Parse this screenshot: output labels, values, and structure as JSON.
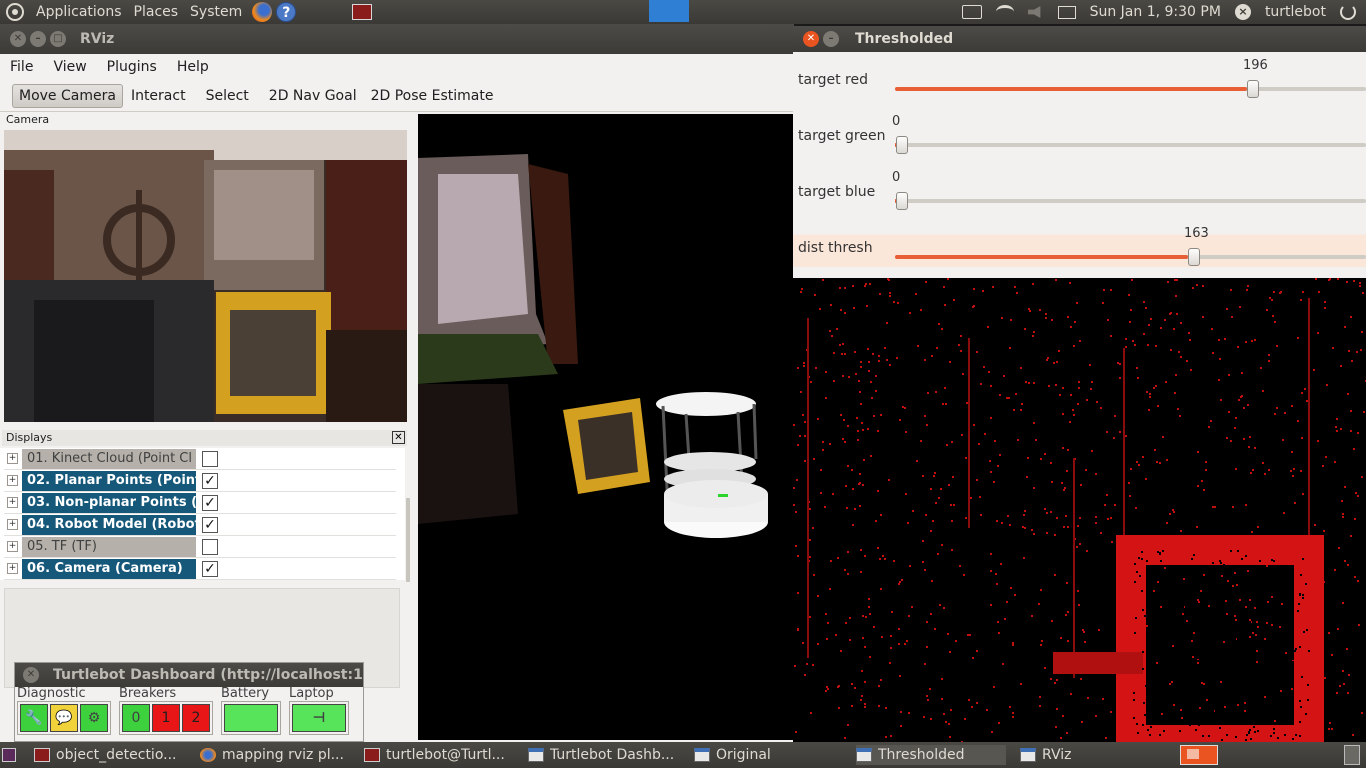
{
  "top_panel": {
    "menus": [
      "Applications",
      "Places",
      "System"
    ],
    "clock": "Sun Jan  1,  9:30 PM",
    "user": "turtlebot"
  },
  "rviz": {
    "title": "RViz",
    "menu": [
      "File",
      "View",
      "Plugins",
      "Help"
    ],
    "tools": [
      "Move Camera",
      "Interact",
      "Select",
      "2D Nav Goal",
      "2D Pose Estimate"
    ],
    "camera_label": "Camera",
    "displays_label": "Displays",
    "displays": [
      {
        "label": "01. Kinect Cloud (Point Cl",
        "checked": false,
        "enabled": false
      },
      {
        "label": "02. Planar Points (Point",
        "checked": true,
        "enabled": true
      },
      {
        "label": "03. Non-planar Points (P",
        "checked": true,
        "enabled": true
      },
      {
        "label": "04. Robot Model (Robot",
        "checked": true,
        "enabled": true
      },
      {
        "label": "05. TF (TF)",
        "checked": false,
        "enabled": false
      },
      {
        "label": "06. Camera (Camera)",
        "checked": true,
        "enabled": true
      }
    ],
    "check_mark": "✓"
  },
  "dashboard": {
    "title": "Turtlebot Dashboard (http://localhost:1",
    "groups": {
      "diagnostic": "Diagnostic",
      "breakers": "Breakers",
      "battery": "Battery",
      "laptop": "Laptop"
    },
    "breaker_labels": [
      "0",
      "1",
      "2"
    ],
    "colors": {
      "ok": "#3ed13e",
      "fault": "#e81616"
    }
  },
  "thresholded": {
    "title": "Thresholded",
    "controls": [
      {
        "label": "target red",
        "value": "196",
        "fraction": 0.769
      },
      {
        "label": "target green",
        "value": "0",
        "fraction": 0.0
      },
      {
        "label": "target blue",
        "value": "0",
        "fraction": 0.0
      },
      {
        "label": "dist thresh",
        "value": "163",
        "fraction": 0.639
      }
    ],
    "accent": "#e95f35"
  },
  "taskbar": {
    "items": [
      {
        "label": "object_detectio...",
        "icon": "terminal-icon"
      },
      {
        "label": "mapping rviz pl...",
        "icon": "firefox-icon"
      },
      {
        "label": "turtlebot@Turtl...",
        "icon": "terminal-icon"
      },
      {
        "label": "Turtlebot Dashb...",
        "icon": "window-icon"
      },
      {
        "label": "Original",
        "icon": "window-icon"
      },
      {
        "label": "Thresholded",
        "icon": "window-icon"
      },
      {
        "label": "RViz",
        "icon": "window-icon"
      }
    ]
  }
}
